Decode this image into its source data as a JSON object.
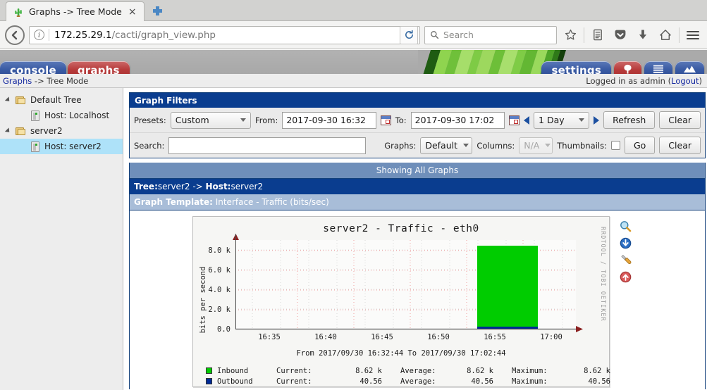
{
  "browser": {
    "tab": {
      "title": "Graphs -> Tree Mode",
      "favicon": "cactus-icon",
      "close": "×"
    },
    "newtab_tooltip": "+",
    "url": {
      "host": "172.25.29.1",
      "path": "/cacti/graph_view.php"
    },
    "search_placeholder": "Search",
    "icons": [
      "back-icon",
      "identity-icon",
      "reload-icon",
      "search-icon",
      "bookmark-star-icon",
      "library-icon",
      "pocket-icon",
      "download-icon",
      "home-icon",
      "menu-icon"
    ]
  },
  "cacti": {
    "tabs_left": [
      {
        "label": "console",
        "color": "blue"
      },
      {
        "label": "graphs",
        "color": "red"
      }
    ],
    "tabs_right": [
      {
        "label": "settings",
        "color": "blue",
        "icon": ""
      },
      {
        "label": "",
        "color": "red",
        "icon": "tree-icon"
      },
      {
        "label": "",
        "color": "blue",
        "icon": "list-icon"
      },
      {
        "label": "",
        "color": "blue",
        "icon": "graph-icon"
      }
    ],
    "breadcrumb_link": "Graphs",
    "breadcrumb_rest": " -> Tree Mode",
    "login_text": "Logged in as admin (",
    "logout_label": "Logout",
    "login_close": ")"
  },
  "sidebar": {
    "nodes": [
      {
        "label": "Default Tree",
        "type": "folder",
        "depth": 0,
        "selected": false
      },
      {
        "label": "Host: Localhost",
        "type": "host",
        "depth": 1,
        "selected": false
      },
      {
        "label": "server2",
        "type": "folder",
        "depth": 0,
        "selected": false
      },
      {
        "label": "Host: server2",
        "type": "host",
        "depth": 1,
        "selected": true
      }
    ]
  },
  "filters": {
    "title": "Graph Filters",
    "presets_label": "Presets:",
    "presets_value": "Custom",
    "from_label": "From:",
    "from_value": "2017-09-30 16:32",
    "to_label": "To:",
    "to_value": "2017-09-30 17:02",
    "span_value": "1 Day",
    "refresh_label": "Refresh",
    "clear_label": "Clear",
    "search_label": "Search:",
    "search_value": "",
    "graphs_label": "Graphs:",
    "graphs_value": "Default",
    "columns_label": "Columns:",
    "columns_value": "N/A",
    "thumbnails_label": "Thumbnails:",
    "thumbnails_checked": false,
    "go_label": "Go",
    "clear2_label": "Clear"
  },
  "results": {
    "showing": "Showing All Graphs",
    "tree_prefix": "Tree:",
    "tree_name": "server2",
    "tree_sep": " -> ",
    "host_prefix": "Host:",
    "host_name": "server2",
    "template_prefix": "Graph Template:",
    "template_name": " Interface - Traffic (bits/sec)",
    "graph_actions": [
      "zoom-icon",
      "csv-export-icon",
      "graph-properties-icon",
      "page-top-icon"
    ]
  },
  "chart_data": {
    "type": "area",
    "title": "server2 - Traffic - eth0",
    "ylabel": "bits per second",
    "watermark": "RRDTOOL / TOBI OETIKER",
    "range_text": "From 2017/09/30 16:32:44 To 2017/09/30 17:02:44",
    "ylim": [
      0,
      9000
    ],
    "yticks": [
      {
        "value": 0,
        "label": "0.0"
      },
      {
        "value": 2000,
        "label": "2.0 k"
      },
      {
        "value": 4000,
        "label": "4.0 k"
      },
      {
        "value": 6000,
        "label": "6.0 k"
      },
      {
        "value": 8000,
        "label": "8.0 k"
      }
    ],
    "xticks": [
      "16:35",
      "16:40",
      "16:45",
      "16:50",
      "16:55",
      "17:00"
    ],
    "xlim": [
      "16:32:44",
      "17:02:44"
    ],
    "grid": true,
    "series": [
      {
        "name": "Inbound",
        "color": "#00CC00",
        "current": "8.62 k",
        "average": "8.62 k",
        "maximum": "8.62 k",
        "values": [
          0,
          0,
          0,
          0,
          0,
          8620,
          8620,
          0
        ]
      },
      {
        "name": "Outbound",
        "color": "#002A97",
        "current": "40.56",
        "average": "40.56",
        "maximum": "40.56",
        "values": [
          0,
          0,
          0,
          0,
          0,
          41,
          41,
          0
        ]
      }
    ],
    "legend_cols": [
      "Current:",
      "Average:",
      "Maximum:"
    ],
    "block": {
      "start_pct": 75.0,
      "end_pct": 92.5,
      "height_value": 8620
    }
  }
}
